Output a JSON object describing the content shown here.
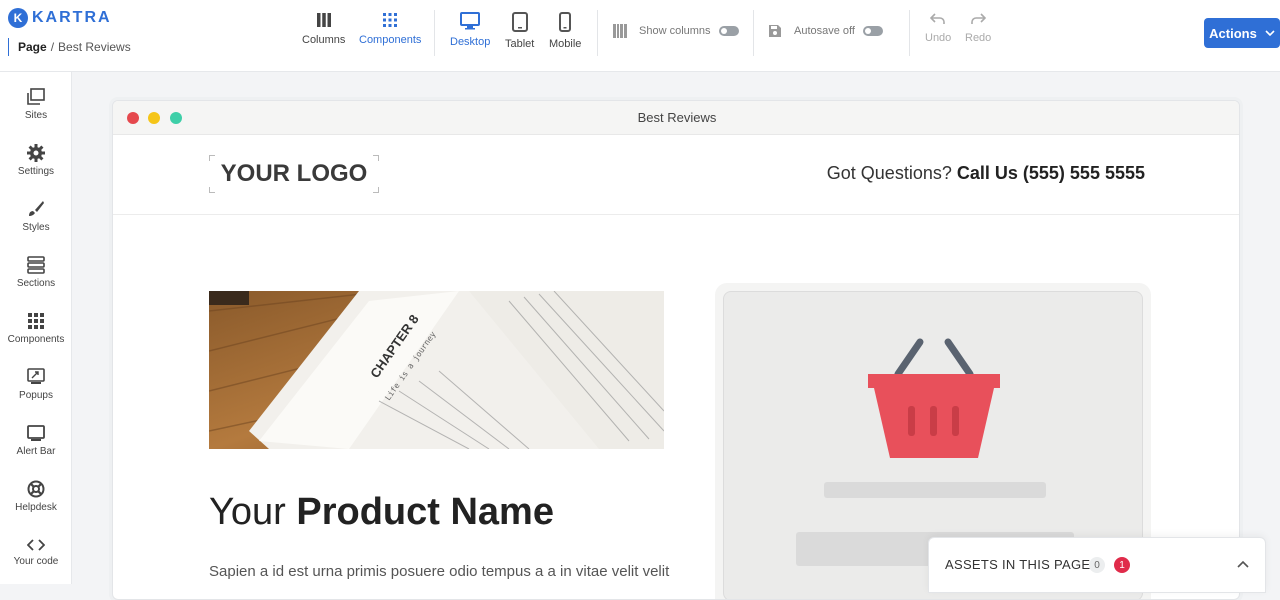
{
  "app": {
    "brand": "KARTRA",
    "brand_mark": "K"
  },
  "breadcrumb": {
    "root": "Page",
    "separator": "/",
    "current": "Best Reviews"
  },
  "toolbar": {
    "columns_label": "Columns",
    "components_label": "Components",
    "desktop_label": "Desktop",
    "tablet_label": "Tablet",
    "mobile_label": "Mobile",
    "show_columns_label": "Show columns",
    "autosave_label": "Autosave off",
    "undo_label": "Undo",
    "redo_label": "Redo",
    "actions_label": "Actions"
  },
  "sidebar": {
    "items": [
      {
        "label": "Sites",
        "icon": "sites-icon"
      },
      {
        "label": "Settings",
        "icon": "gear-icon"
      },
      {
        "label": "Styles",
        "icon": "brush-icon"
      },
      {
        "label": "Sections",
        "icon": "sections-icon"
      },
      {
        "label": "Components",
        "icon": "grid-icon"
      },
      {
        "label": "Popups",
        "icon": "popup-icon"
      },
      {
        "label": "Alert Bar",
        "icon": "alert-bar-icon"
      },
      {
        "label": "Helpdesk",
        "icon": "lifebuoy-icon"
      },
      {
        "label": "Your code",
        "icon": "code-icon"
      }
    ]
  },
  "preview": {
    "window_title": "Best Reviews",
    "logo_text": "YOUR LOGO",
    "phone_prefix": "Got Questions?",
    "phone_bold": "Call Us (555) 555 5555",
    "book_chapter": "CHAPTER 8",
    "book_subtitle": "Life is a journey",
    "product_title_light": "Your",
    "product_title_bold": "Product Name",
    "product_desc": "Sapien a id est urna primis posuere odio tempus a a in vitae velit velit"
  },
  "assets": {
    "label": "ASSETS IN THIS PAGE",
    "count_neutral": "0",
    "count_alert": "1"
  },
  "colors": {
    "accent": "#2f6fd6",
    "basket": "#e8505b",
    "dot_red": "#e5484d",
    "dot_yellow": "#f5c518",
    "dot_green": "#3ecfa8"
  }
}
